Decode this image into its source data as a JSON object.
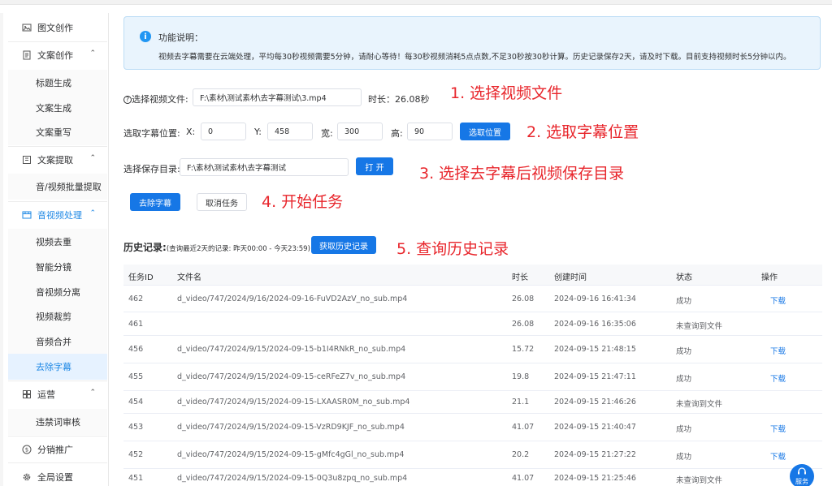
{
  "sidebar": {
    "groups": {
      "tuwen": {
        "label": "图文创作",
        "icon": "image-icon"
      },
      "wenan": {
        "label": "文案创作",
        "icon": "document-icon"
      },
      "tiqu": {
        "label": "文案提取",
        "icon": "extract-icon"
      },
      "yinshipin": {
        "label": "音视频处理",
        "icon": "video-icon"
      },
      "yunying": {
        "label": "运营",
        "icon": "operation-icon"
      },
      "fenxiao": {
        "label": "分销推广",
        "icon": "dollar-icon"
      },
      "quanju": {
        "label": "全局设置",
        "icon": "gear-icon"
      }
    },
    "wenan_items": [
      "标题生成",
      "文案生成",
      "文案重写"
    ],
    "tiqu_items": [
      "音/视频批量提取"
    ],
    "yinshipin_items": [
      "视频去重",
      "智能分镜",
      "音视频分离",
      "视频裁剪",
      "音频合并",
      "去除字幕"
    ],
    "yunying_items": [
      "违禁词审核"
    ],
    "active_item": "去除字幕",
    "accent_color": "#1e88e5"
  },
  "notice": {
    "title": "功能说明：",
    "desc": "视频去字幕需要在云端处理，平均每30秒视频需要5分钟，请耐心等待！每30秒视频消耗5点点数,不足30秒按30秒计算。历史记录保存2天，请及时下载。目前支持视频时长5分钟以内。"
  },
  "form": {
    "file_label": "选择视频文件:",
    "file_value": "F:\\素材\\测试素材\\去字幕测试\\3.mp4",
    "duration_label": "时长：",
    "duration_value": "26.08秒",
    "pos_label": "选取字幕位置:",
    "x_label": "X:",
    "x_value": "0",
    "y_label": "Y:",
    "y_value": "458",
    "w_label": "宽:",
    "w_value": "300",
    "h_label": "高:",
    "h_value": "90",
    "pick_button": "选取位置",
    "dir_label": "选择保存目录:",
    "dir_value": "F:\\素材\\测试素材\\去字幕测试",
    "open_button": "打 开",
    "start_button": "去除字幕",
    "cancel_button": "取消任务"
  },
  "annotations": {
    "a1": "1. 选择视频文件",
    "a2": "2. 选取字幕位置",
    "a3": "3. 选择去字幕后视频保存目录",
    "a4": "4. 开始任务",
    "a5": "5. 查询历史记录",
    "color": "#e8262c"
  },
  "history": {
    "title": "历史记录:",
    "subtitle": "(查询最近2天的记录: 昨天00:00 - 今天23:59)",
    "fetch_button": "获取历史记录",
    "columns": [
      "任务ID",
      "文件名",
      "时长",
      "创建时间",
      "状态",
      "操作"
    ],
    "rows": [
      {
        "id": "462",
        "file": "d_video/747/2024/9/16/2024-09-16-FuVD2AzV_no_sub.mp4",
        "dur": "26.08",
        "time": "2024-09-16 16:41:34",
        "status": "成功",
        "op": "下载"
      },
      {
        "id": "461",
        "file": "",
        "dur": "26.08",
        "time": "2024-09-16 16:35:06",
        "status": "未查询到文件",
        "op": ""
      },
      {
        "id": "456",
        "file": "d_video/747/2024/9/15/2024-09-15-b1I4RNkR_no_sub.mp4",
        "dur": "15.72",
        "time": "2024-09-15 21:48:15",
        "status": "成功",
        "op": "下载"
      },
      {
        "id": "455",
        "file": "d_video/747/2024/9/15/2024-09-15-ceRFeZ7v_no_sub.mp4",
        "dur": "19.8",
        "time": "2024-09-15 21:47:11",
        "status": "成功",
        "op": "下载"
      },
      {
        "id": "454",
        "file": "d_video/747/2024/9/15/2024-09-15-LXAASR0M_no_sub.mp4",
        "dur": "21.1",
        "time": "2024-09-15 21:46:26",
        "status": "未查询到文件",
        "op": ""
      },
      {
        "id": "453",
        "file": "d_video/747/2024/9/15/2024-09-15-VzRD9KJF_no_sub.mp4",
        "dur": "41.07",
        "time": "2024-09-15 21:40:47",
        "status": "成功",
        "op": "下载"
      },
      {
        "id": "452",
        "file": "d_video/747/2024/9/15/2024-09-15-gMfc4gGl_no_sub.mp4",
        "dur": "20.2",
        "time": "2024-09-15 21:27:22",
        "status": "成功",
        "op": "下载"
      },
      {
        "id": "451",
        "file": "d_video/747/2024/9/15/2024-09-15-0Q3u8zpq_no_sub.mp4",
        "dur": "41.07",
        "time": "2024-09-15 21:25:46",
        "status": "未查询到文件",
        "op": ""
      }
    ]
  },
  "service": {
    "label": "服务",
    "icon": "headset-icon"
  }
}
